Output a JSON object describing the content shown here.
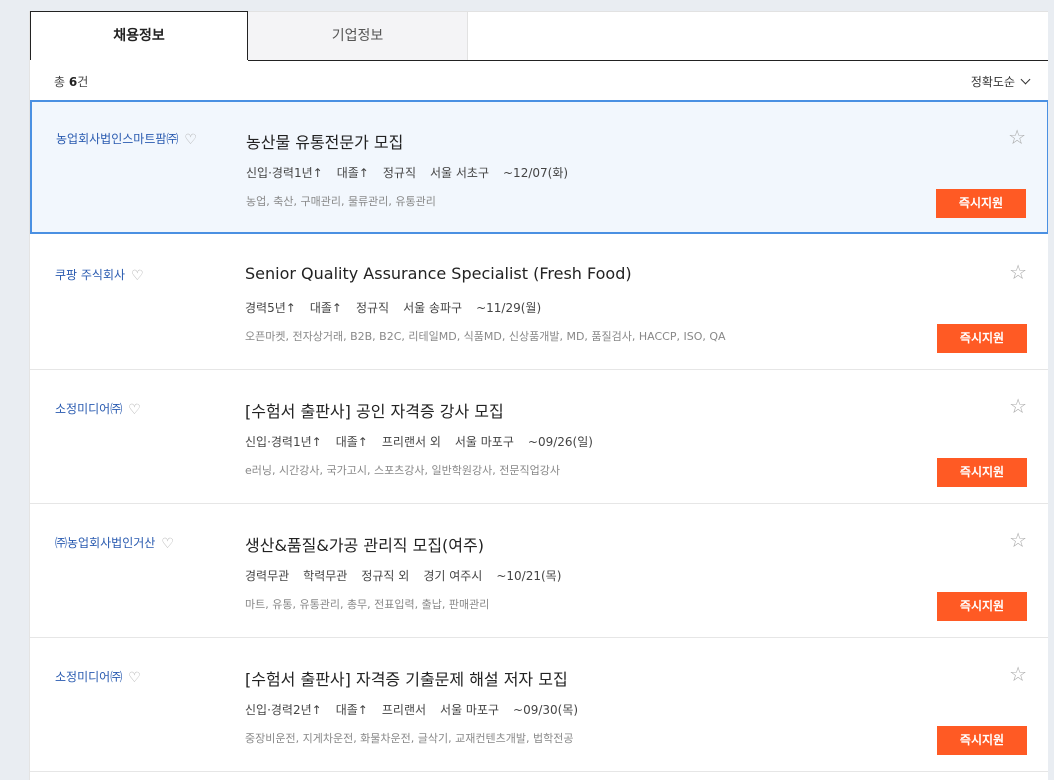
{
  "tabs": [
    {
      "label": "채용정보"
    },
    {
      "label": "기업정보"
    }
  ],
  "summary": {
    "prefix": "총",
    "count": "6",
    "suffix": "건"
  },
  "sort": {
    "label": "정확도순"
  },
  "apply_label": "즉시지원",
  "jobs": [
    {
      "company": "농업회사법인스마트팜㈜",
      "title": "농산물 유통전문가 모집",
      "meta": [
        "신입·경력1년↑",
        "대졸↑",
        "정규직",
        "서울 서초구",
        "~12/07(화)"
      ],
      "tags": "농업, 축산, 구매관리, 물류관리, 유통관리"
    },
    {
      "company": "쿠팡 주식회사",
      "title": "Senior Quality Assurance Specialist (Fresh Food)",
      "meta": [
        "경력5년↑",
        "대졸↑",
        "정규직",
        "서울 송파구",
        "~11/29(월)"
      ],
      "tags": "오픈마켓, 전자상거래, B2B, B2C, 리테일MD, 식품MD, 신상품개발, MD, 품질검사, HACCP, ISO, QA"
    },
    {
      "company": "소정미디어㈜",
      "title": "[수험서 출판사] 공인 자격증 강사 모집",
      "meta": [
        "신입·경력1년↑",
        "대졸↑",
        "프리랜서 외",
        "서울 마포구",
        "~09/26(일)"
      ],
      "tags": "e러닝, 시간강사, 국가고시, 스포츠강사, 일반학원강사, 전문직업강사"
    },
    {
      "company": "㈜농업회사법인거산",
      "title": "생산&품질&가공 관리직 모집(여주)",
      "meta": [
        "경력무관",
        "학력무관",
        "정규직 외",
        "경기 여주시",
        "~10/21(목)"
      ],
      "tags": "마트, 유통, 유통관리, 총무, 전표입력, 출납, 판매관리"
    },
    {
      "company": "소정미디어㈜",
      "title": "[수험서 출판사] 자격증 기출문제 해설 저자 모집",
      "meta": [
        "신입·경력2년↑",
        "대졸↑",
        "프리랜서",
        "서울 마포구",
        "~09/30(목)"
      ],
      "tags": "중장비운전, 지게차운전, 화물차운전, 글삭기, 교재컨텐츠개발, 법학전공"
    }
  ]
}
